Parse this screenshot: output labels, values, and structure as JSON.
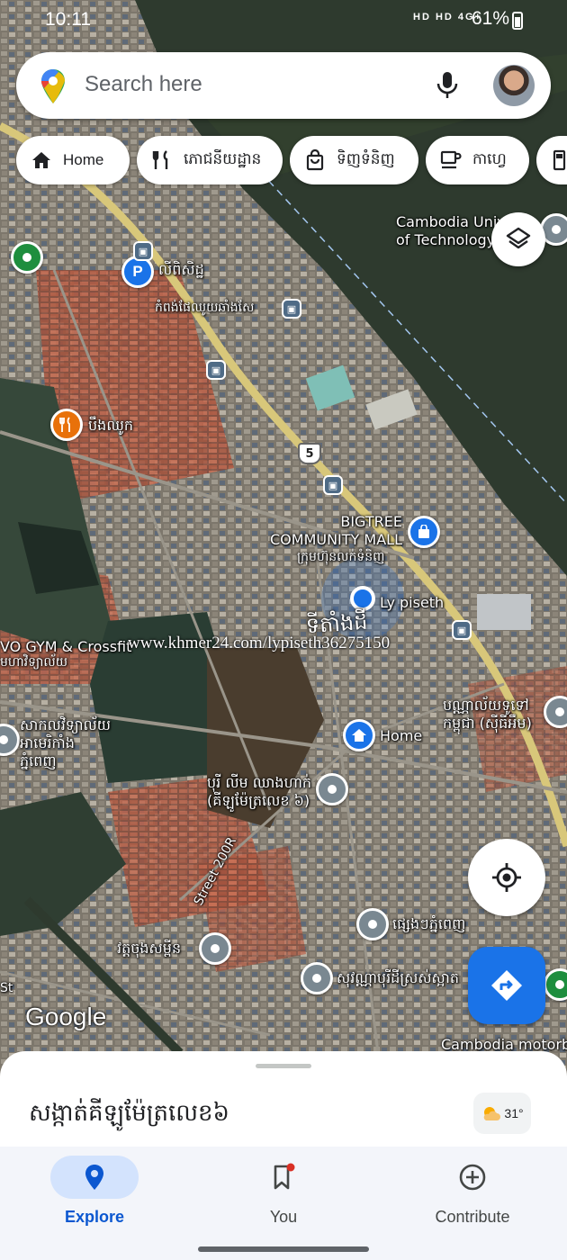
{
  "status_bar": {
    "time": "10:11",
    "network_icons": "HD  HD 4G+",
    "battery": "61%"
  },
  "search": {
    "placeholder": "Search here",
    "logo_icon": "maps-pin-logo",
    "mic_icon": "microphone-icon",
    "avatar": "user-avatar"
  },
  "chips": [
    {
      "label": "Home",
      "icon": "home-icon"
    },
    {
      "label": "ភោជនីយដ្ឋាន",
      "icon": "restaurant-icon"
    },
    {
      "label": "ទិញទំនិញ",
      "icon": "shopping-bag-icon"
    },
    {
      "label": "កាហ្វេ",
      "icon": "coffee-icon"
    },
    {
      "label": "",
      "icon": "gas-station-icon"
    }
  ],
  "map": {
    "labels": {
      "cambodia_univ": "Cambodia Univ\nof Technology",
      "parking": "លីពិសិដ្ឋ",
      "port": "កំពង់ផែឈូយឆាំងសែ",
      "restaurant": "បឹងឈូក",
      "bigtree": "BIGTREE\nCOMMUNITY MALL",
      "bigtree_sub": "ក្រុមហ៊ុនលក់ទំនិញ",
      "user": "Ly piseth",
      "here": "ទីតាំងដី",
      "gym": "VO GYM & Crossfit",
      "gym_sub": "មហាវិទ្យាល័យ",
      "american_univ": "សាកលវិទ្យាល័យ\nអាមេរិកាំង\nភ្នំពេញ",
      "home": "Home",
      "cathedral": "បុរី លីម ឈាងហាក់\n(គីឡូម៉ែត្រលេខ ៦)",
      "right_top": "បណ្ណាល័យទូទៅ\nកម្ពុជា (ស៊ីធីអឹម)",
      "market": "ផ្សេងៗភ្នំពេញ",
      "street": "Street 200R",
      "temple": "វត្តចុងសម្ពីន",
      "shop": "សុវណ្ណាបុរីដីស្រស់ស្អាត",
      "motorbike": "Cambodia motorbi",
      "road_shield": "5",
      "left_st": "St"
    },
    "watermark": "www.khmer24.com/lypiseth36275150",
    "google": "Google",
    "layers_icon": "layers-icon",
    "locate_icon": "my-location-icon",
    "directions_icon": "directions-icon"
  },
  "sheet": {
    "place": "សង្កាត់គីឡូម៉ែត្រលេខ៦",
    "temperature": "31°",
    "weather_icon": "partly-sunny-icon"
  },
  "nav": [
    {
      "label": "Explore",
      "icon": "explore-pin-icon",
      "active": true
    },
    {
      "label": "You",
      "icon": "bookmark-icon",
      "active": false
    },
    {
      "label": "Contribute",
      "icon": "plus-circle-icon",
      "active": false
    }
  ],
  "colors": {
    "accent": "#1a73e8",
    "nav_active_pill": "#d3e3fd",
    "river": "#2c3a30"
  }
}
